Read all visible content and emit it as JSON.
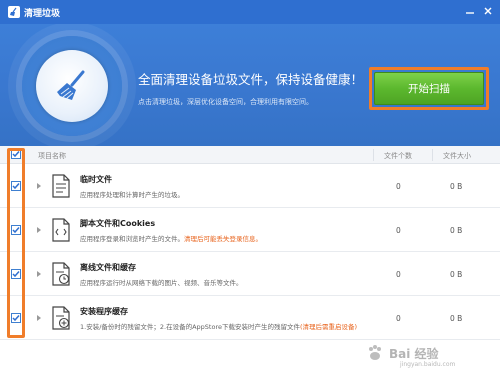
{
  "window": {
    "title": "清理垃圾"
  },
  "hero": {
    "heading": "全面清理设备垃圾文件，保持设备健康！",
    "subtext": "点击清理垃圾，深层优化设备空间，合理利用有限空间。",
    "scan_button": "开始扫描"
  },
  "list": {
    "headers": {
      "name": "项目名称",
      "count": "文件个数",
      "size": "文件大小"
    },
    "rows": [
      {
        "title": "临时文件",
        "desc": "应用程序处理和计算时产生的垃圾。",
        "warn": "",
        "count": "0",
        "size": "0 B",
        "icon": "document-icon"
      },
      {
        "title": "脚本文件和Cookies",
        "desc": "应用程序登录和浏览时产生的文件。",
        "warn": "清理后可能丢失登录信息。",
        "count": "0",
        "size": "0 B",
        "icon": "script-document-icon"
      },
      {
        "title": "离线文件和缓存",
        "desc": "应用程序运行时从网络下载的图片、视频、音乐等文件。",
        "warn": "",
        "count": "0",
        "size": "0 B",
        "icon": "clock-document-icon"
      },
      {
        "title": "安装程序缓存",
        "desc": "1.安装/备份时的残留文件；2.在设备的AppStore下载安装时产生的残留文件",
        "warn": "(清理后需重启设备)",
        "count": "0",
        "size": "0 B",
        "icon": "install-document-icon"
      }
    ]
  },
  "watermark": {
    "text": "Bai 经验",
    "sub": "jingyan.baidu.com"
  },
  "colors": {
    "titlebar": "#2f6fd0",
    "hero": "#3a78d0",
    "scan_button": "#5cb82e",
    "highlight": "#f07d2a",
    "warning": "#e8641e"
  }
}
